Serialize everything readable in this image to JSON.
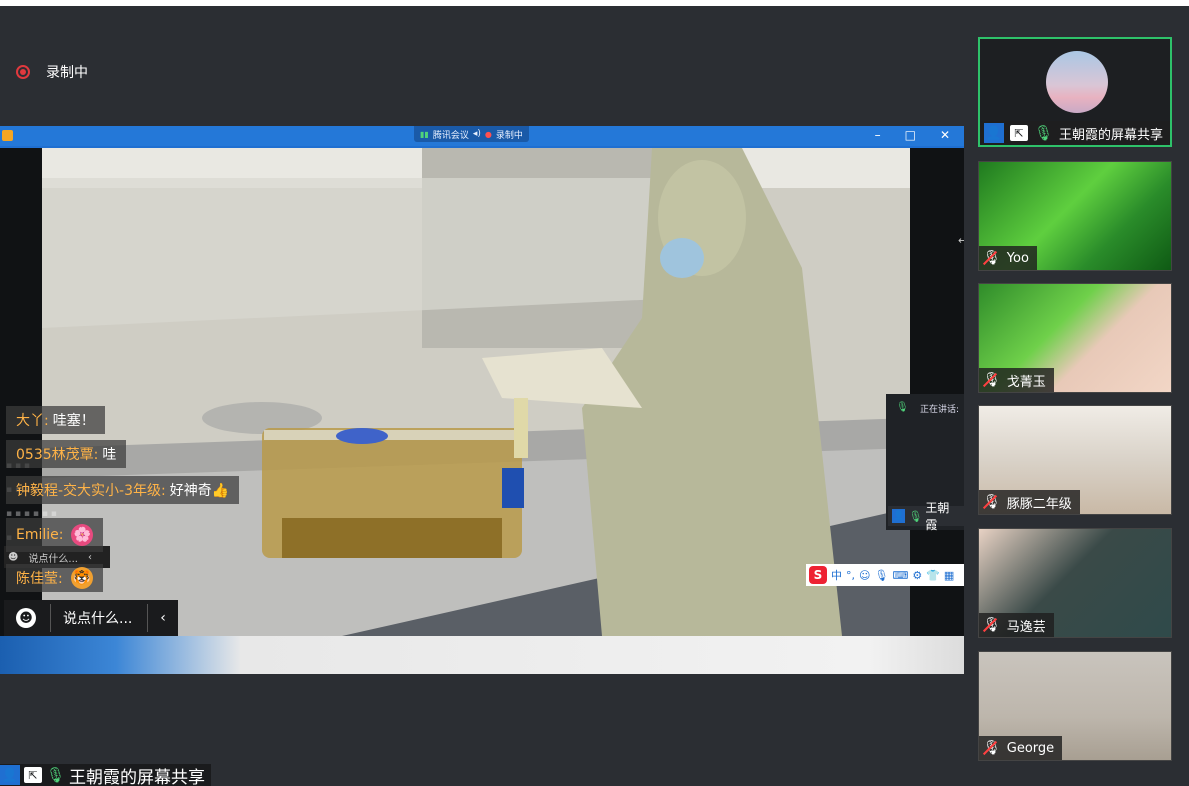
{
  "recording": {
    "label": "录制中"
  },
  "meeting_bar": {
    "app": "腾讯会议",
    "recording": "录制中"
  },
  "shared_window": {
    "controls": [
      "–",
      "□",
      "✕"
    ]
  },
  "speaking": {
    "label": "正在讲话:",
    "name": "王朝霞"
  },
  "ime": {
    "logo": "S",
    "mode": "中"
  },
  "chat": {
    "messages": [
      {
        "name": "大丫:",
        "text": "哇塞！",
        "emoji": ""
      },
      {
        "name": "0535林茂覃:",
        "text": "哇",
        "emoji": ""
      },
      {
        "name": "钟毅程-交大实小-3年级:",
        "text": "好神奇👍",
        "emoji": ""
      },
      {
        "name": "Emilie:",
        "text": "",
        "emoji": "🌸"
      },
      {
        "name": "陈佳莹:",
        "text": "",
        "emoji": "🐯"
      }
    ],
    "input_placeholder": "说点什么...",
    "ghost_placeholder": "说点什么..."
  },
  "bottom_tag": {
    "label": "王朝霞的屏幕共享"
  },
  "participants": [
    {
      "name": "王朝霞的屏幕共享",
      "active": true,
      "mic": "on"
    },
    {
      "name": "Yoo",
      "active": false,
      "mic": "off"
    },
    {
      "name": "戈菁玉",
      "active": false,
      "mic": "off"
    },
    {
      "name": "豚豚二年级",
      "active": false,
      "mic": "off"
    },
    {
      "name": "马逸芸",
      "active": false,
      "mic": "off"
    },
    {
      "name": "George",
      "active": false,
      "mic": "off"
    }
  ],
  "colors": {
    "accent": "#1f6fd1",
    "active_border": "#2ec26a",
    "record_red": "#e0393e",
    "name_orange": "#ffb347"
  }
}
